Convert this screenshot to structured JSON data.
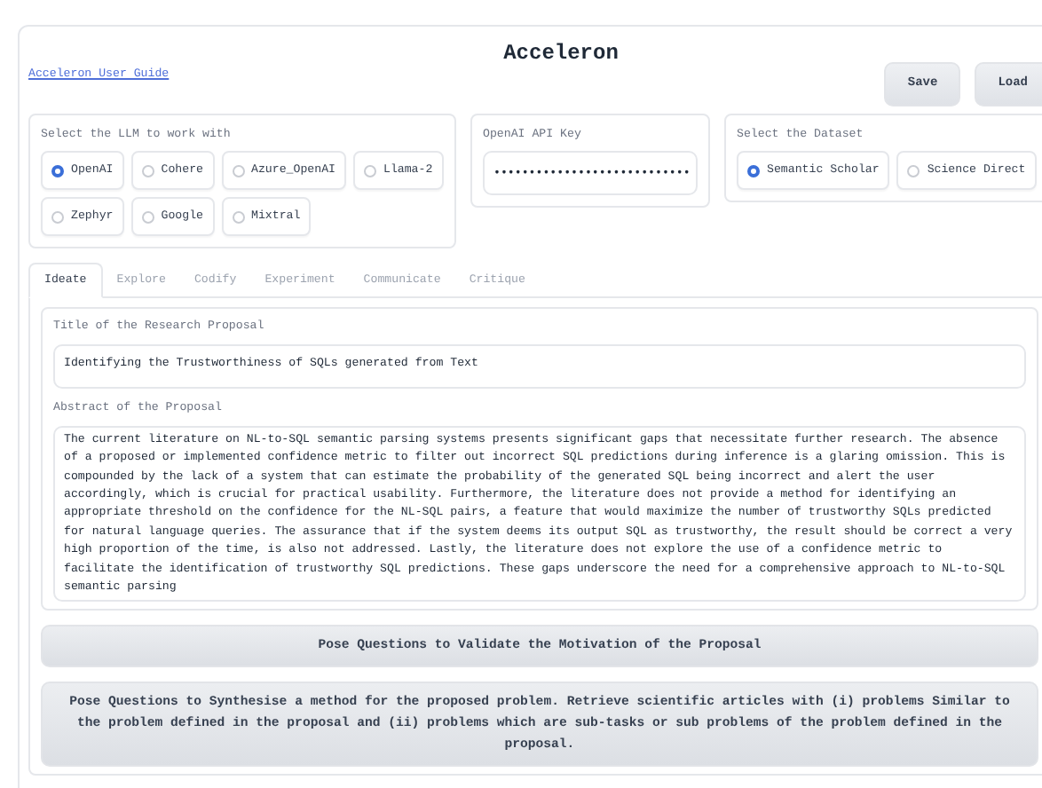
{
  "app": {
    "title": "Acceleron",
    "guide_link": "Acceleron User Guide"
  },
  "header_buttons": [
    "Save",
    "Load"
  ],
  "llm": {
    "label": "Select the LLM to work with",
    "options": [
      {
        "label": "OpenAI",
        "selected": true
      },
      {
        "label": "Cohere",
        "selected": false
      },
      {
        "label": "Azure_OpenAI",
        "selected": false
      },
      {
        "label": "Llama-2",
        "selected": false
      },
      {
        "label": "Zephyr",
        "selected": false
      },
      {
        "label": "Google",
        "selected": false
      },
      {
        "label": "Mixtral",
        "selected": false
      }
    ]
  },
  "api_key": {
    "label": "OpenAI API Key",
    "value": "••••••••••••••••••••••••••••"
  },
  "dataset": {
    "label": "Select the Dataset",
    "options": [
      {
        "label": "Semantic Scholar",
        "selected": true
      },
      {
        "label": "Science Direct",
        "selected": false
      }
    ]
  },
  "tabs": [
    {
      "label": "Ideate",
      "selected": true
    },
    {
      "label": "Explore",
      "selected": false
    },
    {
      "label": "Codify",
      "selected": false
    },
    {
      "label": "Experiment",
      "selected": false
    },
    {
      "label": "Communicate",
      "selected": false
    },
    {
      "label": "Critique",
      "selected": false
    }
  ],
  "proposal_title": {
    "label": "Title of the Research Proposal",
    "value": "Identifying the Trustworthiness of SQLs generated from Text"
  },
  "abstract": {
    "label": "Abstract of the Proposal",
    "value": "The current literature on NL-to-SQL semantic parsing systems presents significant gaps that necessitate further research. The absence of a proposed or implemented confidence metric to filter out incorrect SQL predictions during inference is a glaring omission. This is compounded by the lack of a system that can estimate the probability of the generated SQL being incorrect and alert the user accordingly, which is crucial for practical usability. Furthermore, the literature does not provide a method for identifying an appropriate threshold on the confidence for the NL-SQL pairs, a feature that would maximize the number of trustworthy SQLs predicted for natural language queries. The assurance that if the system deems its output SQL as trustworthy, the result should be correct a very high proportion of the time, is also not addressed. Lastly, the literature does not explore the use of a confidence metric to facilitate the identification of trustworthy SQL predictions. These gaps underscore the need for a comprehensive approach to NL-to-SQL semantic parsing"
  },
  "actions": [
    "Pose Questions to Validate the Motivation of the Proposal",
    "Pose Questions to Synthesise a method for the proposed problem. Retrieve scientific articles with (i) problems Similar to the problem defined in the proposal and (ii) problems which are sub-tasks or sub problems of the problem defined in the proposal."
  ]
}
